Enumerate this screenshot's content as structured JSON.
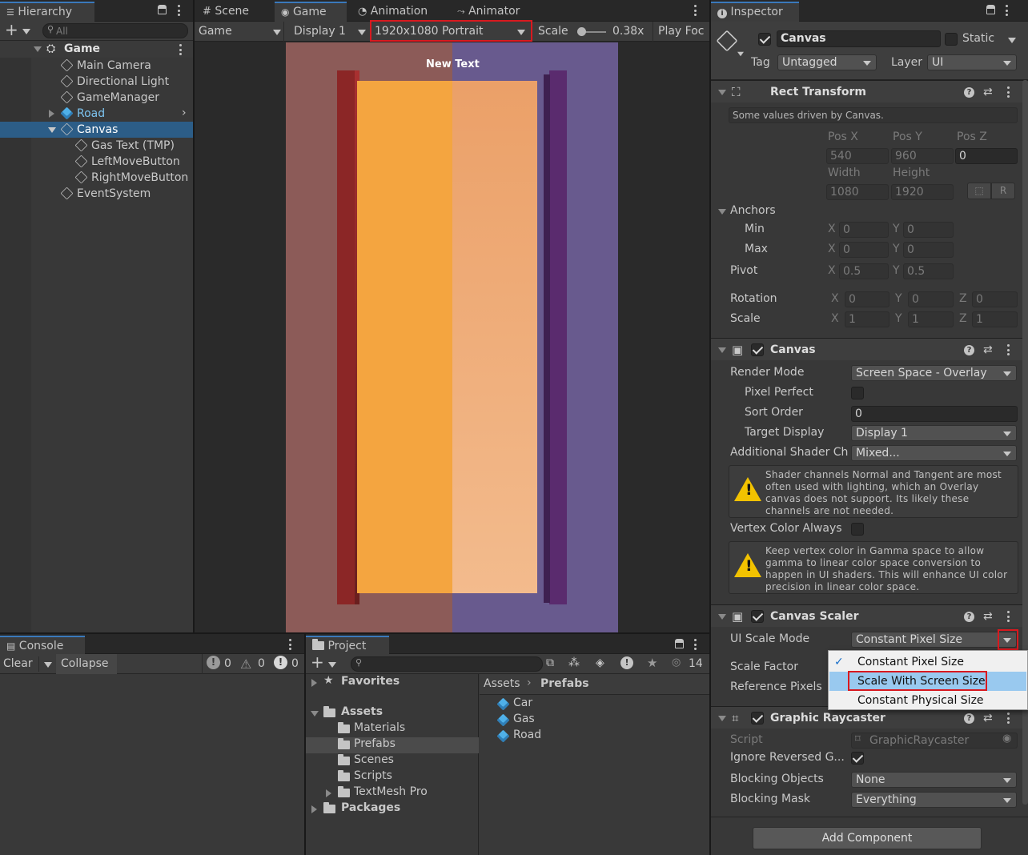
{
  "hierarchy": {
    "tab": "Hierarchy",
    "add": "+",
    "search_placeholder": "All",
    "scene": "Game",
    "items": [
      "Main Camera",
      "Directional Light",
      "GameManager",
      "Road",
      "Canvas",
      "Gas Text (TMP)",
      "LeftMoveButton",
      "RightMoveButton",
      "EventSystem"
    ]
  },
  "game_view": {
    "tabs": [
      "Scene",
      "Game",
      "Animation",
      "Animator"
    ],
    "mode": "Game",
    "display": "Display 1",
    "resolution": "1920x1080 Portrait",
    "scale_label": "Scale",
    "scale_value": "0.38x",
    "play_focus": "Play Foc",
    "new_text": "New Text",
    "colors": {
      "left_half": "#8c5b58",
      "right_half": "#685a8e",
      "road": "#f4a540",
      "road_right": "#f1b383",
      "wall_left": "#8b2626",
      "wall_right": "#5a2b6e",
      "backdrop": "#2a2a2a"
    }
  },
  "console": {
    "tab": "Console",
    "clear": "Clear",
    "collapse": "Collapse",
    "info_count": "0",
    "warn_count": "0",
    "error_count": "0"
  },
  "project": {
    "tab": "Project",
    "add": "+",
    "hidden_count": "14",
    "tree": {
      "favorites": "Favorites",
      "assets": "Assets",
      "folders": [
        "Materials",
        "Prefabs",
        "Scenes",
        "Scripts",
        "TextMesh Pro"
      ],
      "packages": "Packages"
    },
    "breadcrumb": [
      "Assets",
      "Prefabs"
    ],
    "files": [
      "Car",
      "Gas",
      "Road"
    ]
  },
  "inspector": {
    "tab": "Inspector",
    "object_name": "Canvas",
    "static_label": "Static",
    "tag_label": "Tag",
    "tag_value": "Untagged",
    "layer_label": "Layer",
    "layer_value": "UI",
    "rect_transform": {
      "title": "Rect Transform",
      "note": "Some values driven by Canvas.",
      "posx_label": "Pos X",
      "posy_label": "Pos Y",
      "posz_label": "Pos Z",
      "posx": "540",
      "posy": "960",
      "posz": "0",
      "width_label": "Width",
      "height_label": "Height",
      "width": "1080",
      "height": "1920",
      "anchors_label": "Anchors",
      "min_label": "Min",
      "max_label": "Max",
      "pivot_label": "Pivot",
      "min_x": "0",
      "min_y": "0",
      "max_x": "0",
      "max_y": "0",
      "pivot_x": "0.5",
      "pivot_y": "0.5",
      "rotation_label": "Rotation",
      "scale_label": "Scale",
      "rot_x": "0",
      "rot_y": "0",
      "rot_z": "0",
      "scale_x": "1",
      "scale_y": "1",
      "scale_z": "1",
      "x": "X",
      "y": "Y",
      "z": "Z",
      "r_button": "R"
    },
    "canvas": {
      "title": "Canvas",
      "render_mode_label": "Render Mode",
      "render_mode": "Screen Space - Overlay",
      "pixel_perfect_label": "Pixel Perfect",
      "sort_order_label": "Sort Order",
      "sort_order": "0",
      "target_display_label": "Target Display",
      "target_display": "Display 1",
      "shader_label": "Additional Shader Ch",
      "shader_value": "Mixed...",
      "warning1": "Shader channels Normal and Tangent are most often used with lighting, which an Overlay canvas does not support. Its likely these channels are not needed.",
      "vertex_label": "Vertex Color Always",
      "warning2": "Keep vertex color in Gamma space to allow gamma to linear color space conversion to happen in UI shaders. This will enhance UI color precision in linear color space."
    },
    "canvas_scaler": {
      "title": "Canvas Scaler",
      "mode_label": "UI Scale Mode",
      "mode_value": "Constant Pixel Size",
      "scale_factor_label": "Scale Factor",
      "ref_pixels_label": "Reference Pixels",
      "options": [
        "Constant Pixel Size",
        "Scale With Screen Size",
        "Constant Physical Size"
      ]
    },
    "graphic_raycaster": {
      "title": "Graphic Raycaster",
      "script_label": "Script",
      "script_value": "GraphicRaycaster",
      "ignore_label": "Ignore Reversed G...",
      "blocking_objects_label": "Blocking Objects",
      "blocking_objects": "None",
      "blocking_mask_label": "Blocking Mask",
      "blocking_mask": "Everything"
    },
    "add_component": "Add Component"
  }
}
